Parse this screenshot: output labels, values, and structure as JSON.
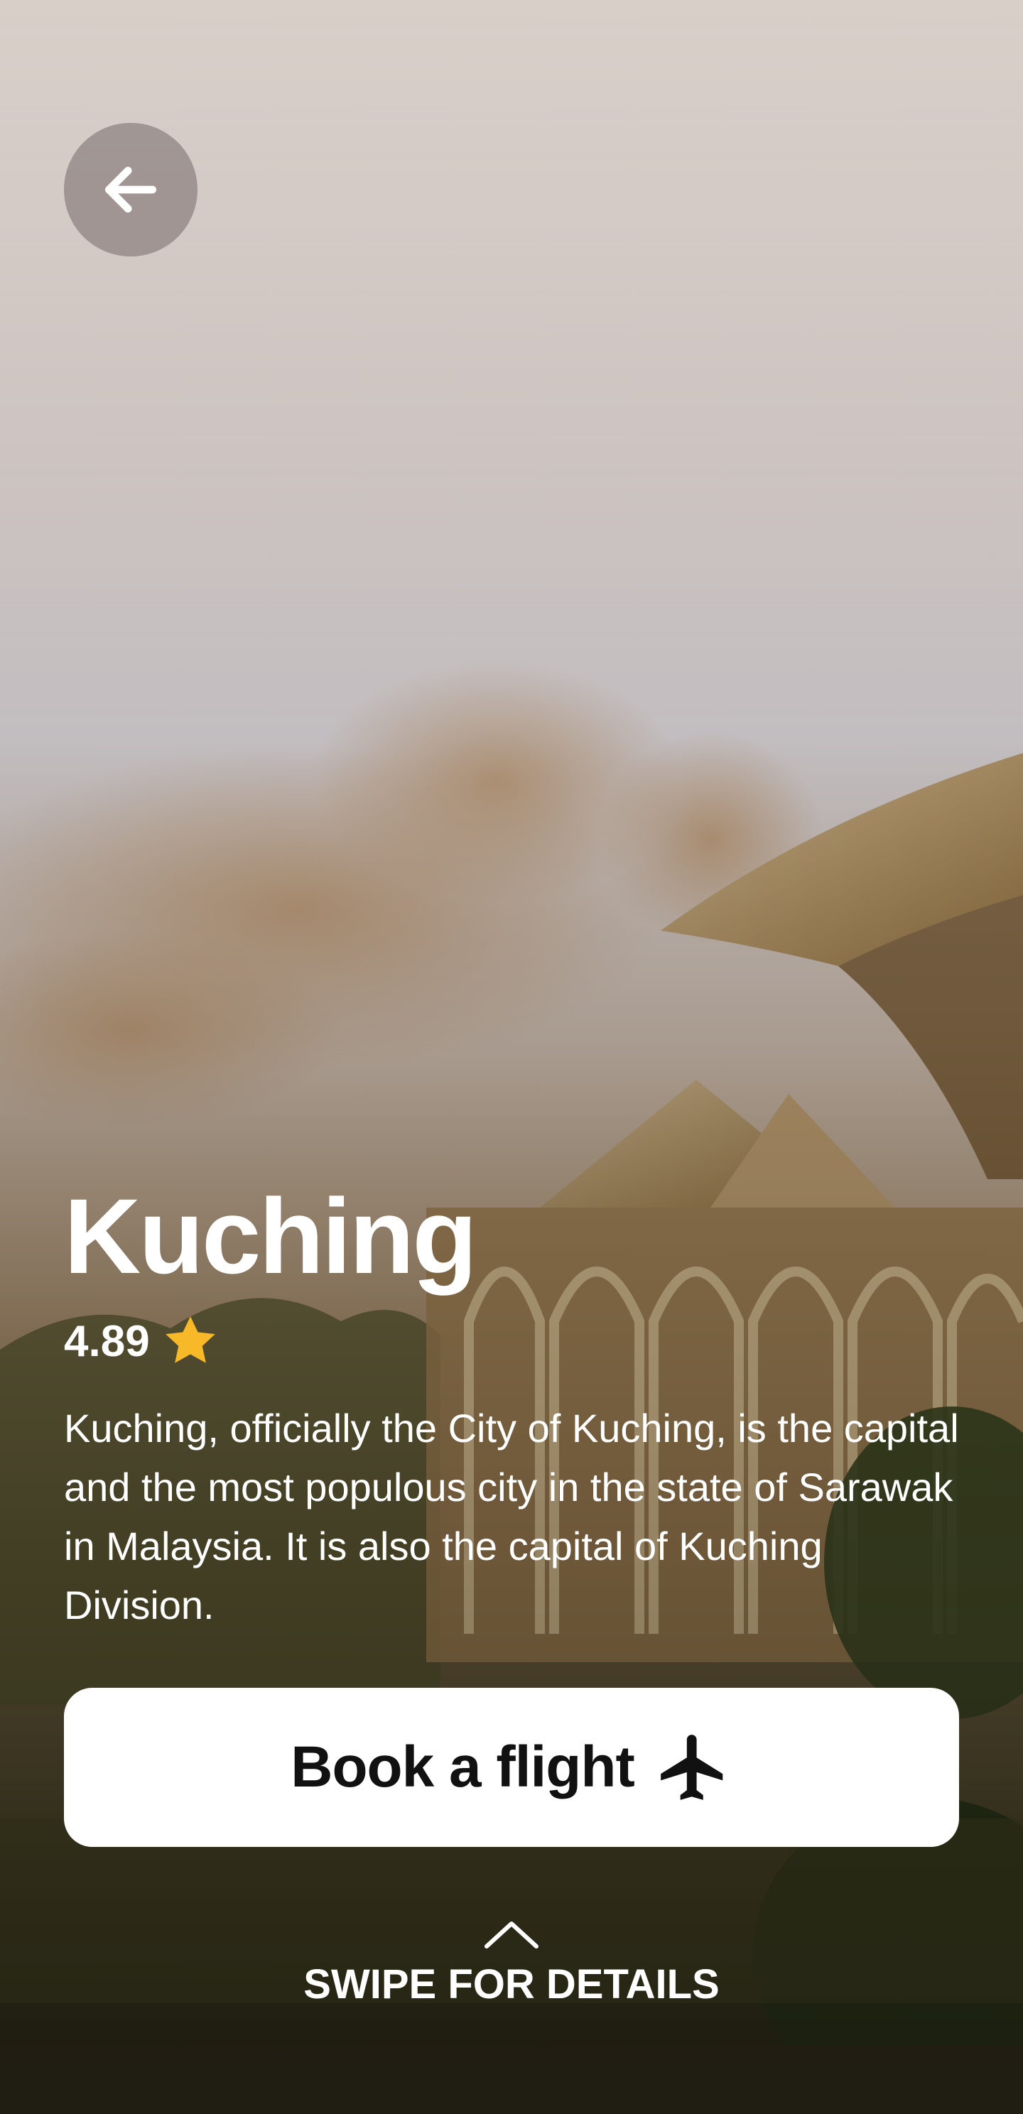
{
  "destination": {
    "name": "Kuching",
    "rating": "4.89",
    "description": "Kuching, officially the City of Kuching, is the capital and the most populous city in the state of Sarawak in Malaysia. It is also the capital of Kuching Division."
  },
  "actions": {
    "book_label": "Book a flight",
    "swipe_label": "SWIPE FOR DETAILS"
  },
  "icons": {
    "back": "arrow-left-icon",
    "rating": "star-icon",
    "book": "airplane-icon",
    "swipe": "chevron-up-icon"
  },
  "colors": {
    "star": "#F7B928",
    "button_bg": "#FFFFFF",
    "button_text": "#111111",
    "overlay_text": "#FFFFFF"
  }
}
